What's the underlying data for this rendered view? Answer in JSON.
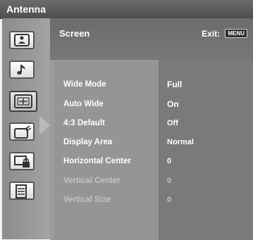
{
  "topbar": {
    "title": "Antenna"
  },
  "header": {
    "title": "Screen",
    "exit_label": "Exit:",
    "menu_key": "MENU"
  },
  "sidebar": {
    "items": [
      {
        "icon": "picture-icon"
      },
      {
        "icon": "music-note-icon"
      },
      {
        "icon": "screen-icon",
        "selected": true
      },
      {
        "icon": "setup-icon"
      },
      {
        "icon": "parental-lock-icon"
      },
      {
        "icon": "settings-list-icon"
      }
    ]
  },
  "rows": [
    {
      "label": "Wide Mode",
      "value": "Full",
      "enabled": true
    },
    {
      "label": "Auto Wide",
      "value": "On",
      "enabled": true
    },
    {
      "label": "4:3 Default",
      "value": "Off",
      "enabled": true
    },
    {
      "label": "Display Area",
      "value": "Normal",
      "enabled": true
    },
    {
      "label": "Horizontal Center",
      "value": "0",
      "enabled": true
    },
    {
      "label": "Vertical Center",
      "value": "0",
      "enabled": false
    },
    {
      "label": "Vertical Size",
      "value": "0",
      "enabled": false
    }
  ]
}
